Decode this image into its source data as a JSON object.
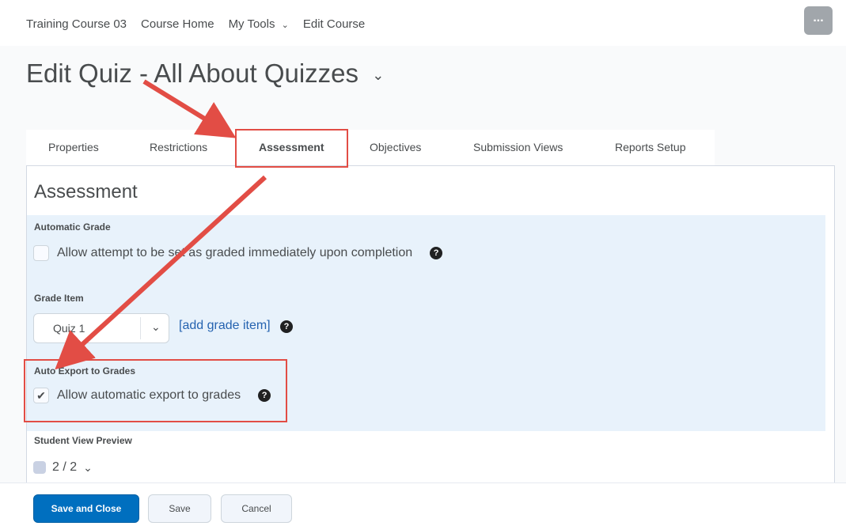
{
  "nav": {
    "items": [
      "Training Course 03",
      "Course Home",
      "My Tools",
      "Edit Course"
    ],
    "more_label": "..."
  },
  "page": {
    "title": "Edit Quiz - All About Quizzes",
    "title_chevron": "⌄"
  },
  "tabs": [
    "Properties",
    "Restrictions",
    "Assessment",
    "Objectives",
    "Submission Views",
    "Reports Setup"
  ],
  "active_tab": "Assessment",
  "assessment": {
    "heading": "Assessment",
    "automatic_grade": {
      "label": "Automatic Grade",
      "checkbox_label": "Allow attempt to be set as graded immediately upon completion",
      "checked": false
    },
    "grade_item": {
      "label": "Grade Item",
      "selected": "Quiz 1",
      "add_link": "[add grade item]"
    },
    "auto_export": {
      "label": "Auto Export to Grades",
      "checkbox_label": "Allow automatic export to grades",
      "checked": true
    },
    "student_view": {
      "label": "Student View Preview",
      "value": "2 / 2"
    }
  },
  "footer": {
    "save_close": "Save and Close",
    "save": "Save",
    "cancel": "Cancel"
  },
  "colors": {
    "annotation": "#e24d45",
    "primary": "#006fbf",
    "link": "#2563b0",
    "panel_highlight": "#e8f2fb"
  },
  "icons": {
    "help": "help-icon",
    "checkmark": "checkmark-icon",
    "chevron": "chevron-down-icon"
  }
}
